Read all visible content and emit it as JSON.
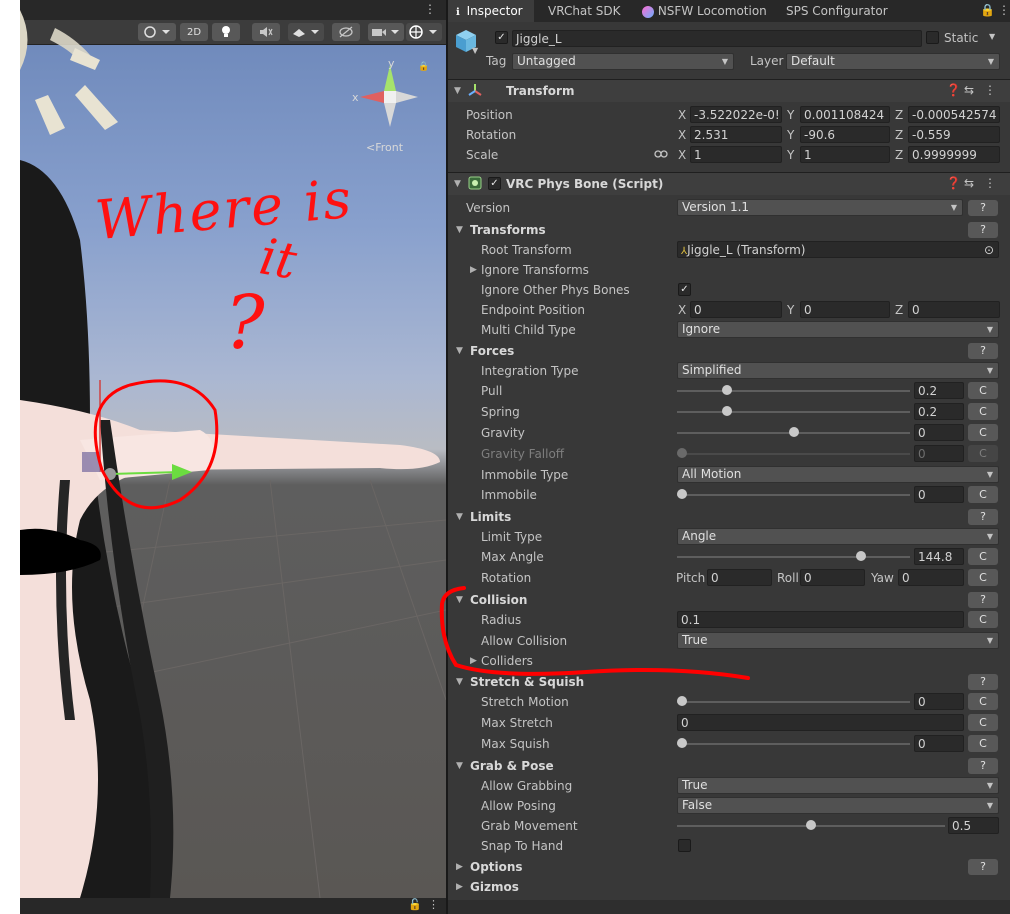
{
  "scene": {
    "toolbar": {
      "btn_2d": "2D",
      "menu_dots": "⋮"
    },
    "gizmo": {
      "x_label": "x",
      "y_label": "y",
      "view_label": "Front"
    },
    "annotation": {
      "line1": "Where is",
      "line2": "it",
      "line3": "?"
    }
  },
  "inspector": {
    "tabs": [
      "Inspector",
      "VRChat SDK",
      "NSFW Locomotion",
      "SPS Configurator"
    ],
    "object": {
      "active": true,
      "name": "Jiggle_L",
      "static_label": "Static",
      "tag_label": "Tag",
      "tag_value": "Untagged",
      "layer_label": "Layer",
      "layer_value": "Default"
    },
    "transform": {
      "title": "Transform",
      "position_label": "Position",
      "rotation_label": "Rotation",
      "scale_label": "Scale",
      "position": {
        "x": "-3.522022e-0!",
        "y": "0.001108424",
        "z": "-0.000542574"
      },
      "rotation": {
        "x": "2.531",
        "y": "-90.6",
        "z": "-0.559"
      },
      "scale": {
        "x": "1",
        "y": "1",
        "z": "0.9999999"
      }
    },
    "physbone": {
      "title": "VRC Phys Bone (Script)",
      "version_label": "Version",
      "version_value": "Version 1.1",
      "help": "?",
      "transforms": {
        "title": "Transforms",
        "root_transform_label": "Root Transform",
        "root_transform_value": "Jiggle_L (Transform)",
        "ignore_transforms_label": "Ignore Transforms",
        "ignore_other_label": "Ignore Other Phys Bones",
        "endpoint_label": "Endpoint Position",
        "endpoint": {
          "x": "0",
          "y": "0",
          "z": "0"
        },
        "multi_child_label": "Multi Child Type",
        "multi_child_value": "Ignore"
      },
      "forces": {
        "title": "Forces",
        "integration_label": "Integration Type",
        "integration_value": "Simplified",
        "pull_label": "Pull",
        "pull_value": "0.2",
        "pull_level": 0.2,
        "spring_label": "Spring",
        "spring_value": "0.2",
        "spring_level": 0.2,
        "gravity_label": "Gravity",
        "gravity_value": "0",
        "gravity_level": 0.5,
        "gravity_falloff_label": "Gravity Falloff",
        "gravity_falloff_value": "0",
        "gravity_falloff_level": 0,
        "immobile_type_label": "Immobile Type",
        "immobile_type_value": "All Motion",
        "immobile_label": "Immobile",
        "immobile_value": "0",
        "immobile_level": 0
      },
      "limits": {
        "title": "Limits",
        "limit_type_label": "Limit Type",
        "limit_type_value": "Angle",
        "max_angle_label": "Max Angle",
        "max_angle_value": "144.8",
        "max_angle_level": 0.804,
        "rotation_label": "Rotation",
        "pitch_label": "Pitch",
        "pitch_value": "0",
        "roll_label": "Roll",
        "roll_value": "0",
        "yaw_label": "Yaw",
        "yaw_value": "0"
      },
      "collision": {
        "title": "Collision",
        "radius_label": "Radius",
        "radius_value": "0.1",
        "allow_collision_label": "Allow Collision",
        "allow_collision_value": "True",
        "colliders_label": "Colliders"
      },
      "stretch": {
        "title": "Stretch & Squish",
        "stretch_motion_label": "Stretch Motion",
        "stretch_motion_value": "0",
        "stretch_motion_level": 0,
        "max_stretch_label": "Max Stretch",
        "max_stretch_value": "0",
        "max_squish_label": "Max Squish",
        "max_squish_value": "0",
        "max_squish_level": 0
      },
      "grab": {
        "title": "Grab & Pose",
        "allow_grabbing_label": "Allow Grabbing",
        "allow_grabbing_value": "True",
        "allow_posing_label": "Allow Posing",
        "allow_posing_value": "False",
        "grab_movement_label": "Grab Movement",
        "grab_movement_value": "0.5",
        "grab_movement_level": 0.5,
        "snap_label": "Snap To Hand"
      },
      "options_label": "Options",
      "gizmos_label": "Gizmos",
      "c_label": "C"
    }
  }
}
